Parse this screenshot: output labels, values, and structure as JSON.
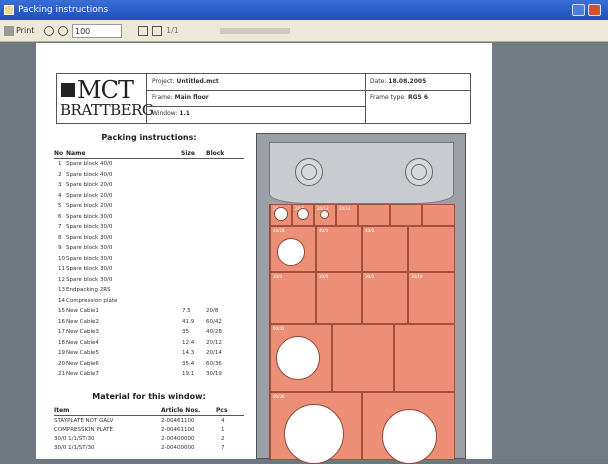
{
  "window": {
    "title": "Packing instructions",
    "title_color": "#2457c9"
  },
  "toolbar": {
    "print_label": "Print",
    "zoom_value": "100",
    "page_label": "1/1"
  },
  "header": {
    "logo_main": "MCT",
    "logo_sub": "BRATTBERG",
    "project_label": "Project:",
    "project_value": "Untitled.mct",
    "frame_label": "Frame:",
    "frame_value": "Main floor",
    "window_label": "Window:",
    "window_value": "1.1",
    "date_label": "Date:",
    "date_value": "18.08.2005",
    "frame_type_label": "Frame type:",
    "frame_type_value": "RGS 6"
  },
  "packing": {
    "title": "Packing instructions:",
    "col_no": "No",
    "col_name": "Name",
    "col_size": "Size",
    "col_block": "Block",
    "rows": [
      {
        "no": "1",
        "name": "Spare block 40/0",
        "size": "",
        "block": ""
      },
      {
        "no": "2",
        "name": "Spare block 40/0",
        "size": "",
        "block": ""
      },
      {
        "no": "3",
        "name": "Spare block 20/0",
        "size": "",
        "block": ""
      },
      {
        "no": "4",
        "name": "Spare block 20/0",
        "size": "",
        "block": ""
      },
      {
        "no": "5",
        "name": "Spare block 20/0",
        "size": "",
        "block": ""
      },
      {
        "no": "6",
        "name": "Spare block 30/0",
        "size": "",
        "block": ""
      },
      {
        "no": "7",
        "name": "Spare block 30/0",
        "size": "",
        "block": ""
      },
      {
        "no": "8",
        "name": "Spare block 30/0",
        "size": "",
        "block": ""
      },
      {
        "no": "9",
        "name": "Spare block 30/0",
        "size": "",
        "block": ""
      },
      {
        "no": "10",
        "name": "Spare block 30/0",
        "size": "",
        "block": ""
      },
      {
        "no": "11",
        "name": "Spare block 30/0",
        "size": "",
        "block": ""
      },
      {
        "no": "12",
        "name": "Spare block 30/0",
        "size": "",
        "block": ""
      },
      {
        "no": "13",
        "name": "Endpacking 2RS",
        "size": "",
        "block": ""
      },
      {
        "no": "14",
        "name": "Compression plate",
        "size": "",
        "block": ""
      },
      {
        "no": "15",
        "name": "New Cable1",
        "size": "7.5",
        "block": "20/8"
      },
      {
        "no": "16",
        "name": "New Cable2",
        "size": "41.9",
        "block": "60/42"
      },
      {
        "no": "17",
        "name": "New Cable3",
        "size": "35",
        "block": "40/28"
      },
      {
        "no": "18",
        "name": "New Cable4",
        "size": "12.4",
        "block": "20/12"
      },
      {
        "no": "19",
        "name": "New Cable5",
        "size": "14.3",
        "block": "20/14"
      },
      {
        "no": "20",
        "name": "New Cable6",
        "size": "35.4",
        "block": "60/36"
      },
      {
        "no": "21",
        "name": "New Cable7",
        "size": "19.1",
        "block": "30/19"
      }
    ]
  },
  "material": {
    "title": "Material for this window:",
    "col_item": "Item",
    "col_article": "Article Nos.",
    "col_pcs": "Pcs",
    "rows": [
      {
        "item": "STAYPLATE NOT GALV",
        "article": "2-00461100",
        "pcs": "4"
      },
      {
        "item": "COMPRESSION PLATE",
        "article": "2-00461100",
        "pcs": "1"
      },
      {
        "item": "30/0 1/1/ST/30",
        "article": "2-00400000",
        "pcs": "2"
      },
      {
        "item": "30/0 1/1/ST/30",
        "article": "2-00400000",
        "pcs": "7"
      }
    ]
  },
  "frame": {
    "blocks": [
      "20/8",
      "20/8",
      "20/12",
      "20/14",
      "40/28",
      "40/0",
      "40/0",
      "30/0",
      "30/0",
      "30/0",
      "30/19",
      "60/42",
      "60/36"
    ],
    "colors": {
      "block": "#ec8f76",
      "head": "#c8cbcf"
    }
  }
}
